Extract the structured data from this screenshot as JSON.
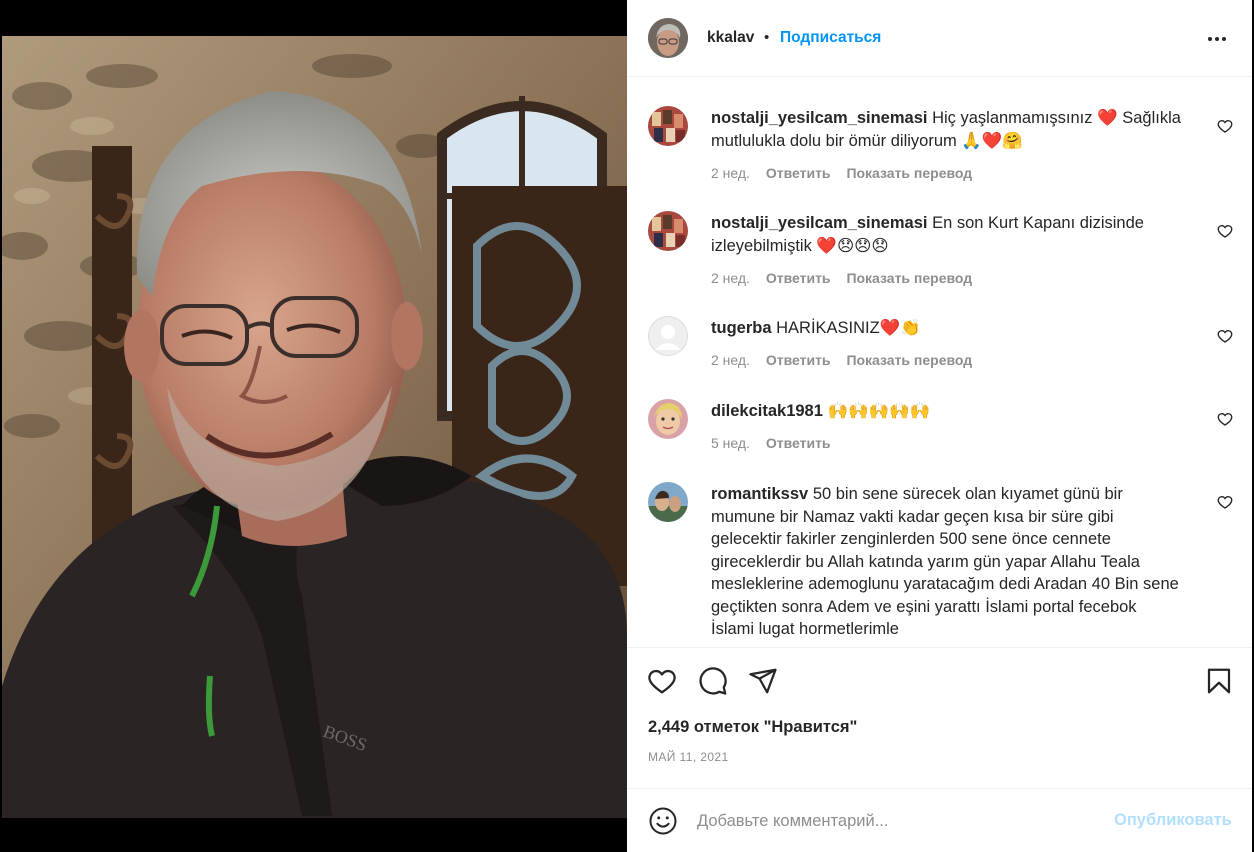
{
  "post": {
    "author": "kkalav",
    "separator": "•",
    "follow_label": "Подписаться",
    "more_label": "..."
  },
  "comments": [
    {
      "user": "nostalji_yesilcam_sinemasi",
      "text": "Hiç yaşlanmamışsınız ❤️ Sağlıkla mutlulukla dolu bir ömür diliyorum 🙏❤️🤗",
      "age": "2 нед.",
      "reply": "Ответить",
      "translate": "Показать перевод"
    },
    {
      "user": "nostalji_yesilcam_sinemasi",
      "text": "En son Kurt Kapanı dizisinde izleyebilmiştik ❤️😞😞😞",
      "age": "2 нед.",
      "reply": "Ответить",
      "translate": "Показать перевод"
    },
    {
      "user": "tugerba",
      "text": "HARİKASINIZ❤️👏",
      "age": "2 нед.",
      "reply": "Ответить",
      "translate": "Показать перевод"
    },
    {
      "user": "dilekcitak1981",
      "text": "🙌🙌🙌🙌🙌",
      "age": "5 нед.",
      "reply": "Ответить"
    },
    {
      "user": "romantikssv",
      "text": "50 bin sene sürecek olan kıyamet günü bir mumune bir Namaz vakti kadar geçen kısa bir süre gibi gelecektir fakirler zenginlerden 500 sene önce cennete gireceklerdir bu Allah katında yarım gün yapar Allahu Teala mesleklerine ademoglunu yaratacağım dedi Aradan 40 Bin sene geçtikten sonra Adem ve eşini yarattı İslami portal fecebok İslami lugat hormetlerimle"
    }
  ],
  "actions": {
    "icons": [
      "heart-icon",
      "comment-icon",
      "share-icon",
      "bookmark-icon"
    ]
  },
  "likes": "2,449 отметок \"Нравится\"",
  "date": "МАЙ 11, 2021",
  "composer": {
    "placeholder": "Добавьте комментарий...",
    "publish_label": "Опубликовать"
  },
  "colors": {
    "accent": "#0095f6",
    "publish_disabled": "#b2dffc",
    "text": "#262626",
    "muted": "#8e8e8e",
    "divider": "#efefef"
  }
}
